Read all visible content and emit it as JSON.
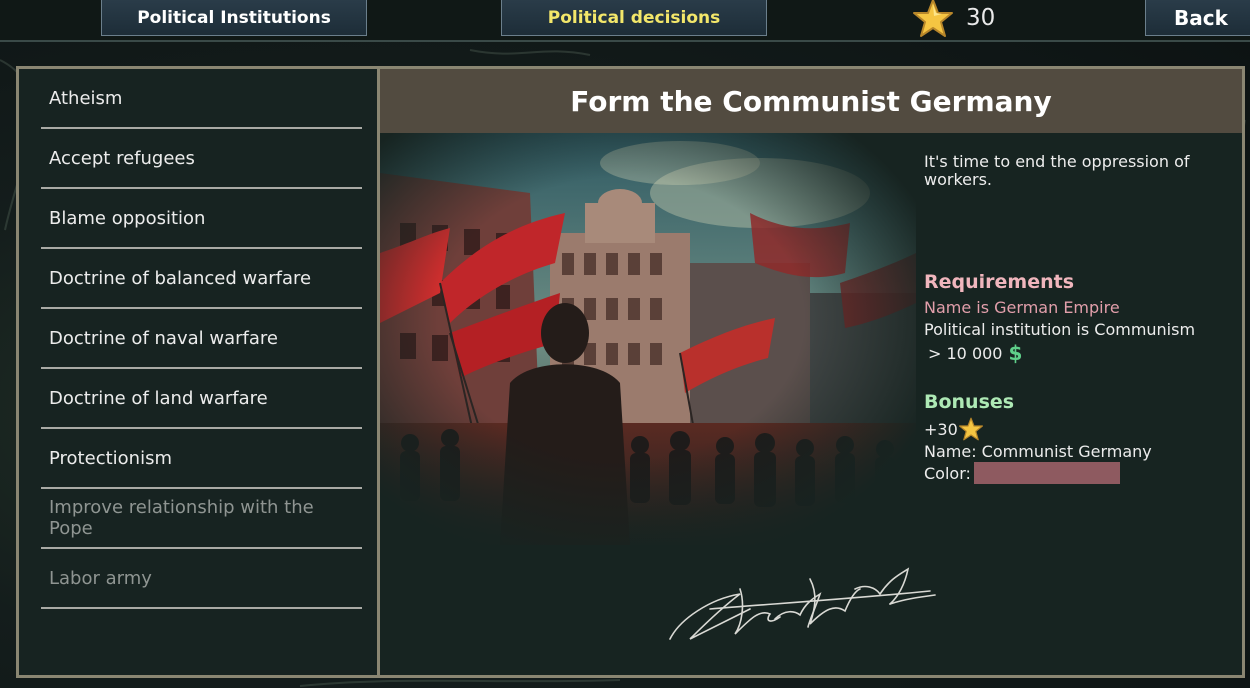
{
  "topbar": {
    "institutions_label": "Political Institutions",
    "decisions_label": "Political decisions",
    "stars_count": "30",
    "back_label": "Back"
  },
  "sidebar": {
    "items": [
      {
        "label": "Atheism",
        "enabled": true
      },
      {
        "label": "Accept refugees",
        "enabled": true
      },
      {
        "label": "Blame opposition",
        "enabled": true
      },
      {
        "label": "Doctrine of balanced warfare",
        "enabled": true
      },
      {
        "label": "Doctrine of naval warfare",
        "enabled": true
      },
      {
        "label": "Doctrine of land warfare",
        "enabled": true
      },
      {
        "label": "Protectionism",
        "enabled": true
      },
      {
        "label": "Improve relationship with the Pope",
        "enabled": false
      },
      {
        "label": "Labor army",
        "enabled": false
      }
    ]
  },
  "decision": {
    "title": "Form the Communist Germany",
    "description": "It's time to end the oppression of workers.",
    "requirements_heading": "Requirements",
    "requirements": {
      "name": "Name is German Empire",
      "institution": "Political institution is Communism",
      "money": "> 10 000"
    },
    "money_icon": "dollar-icon",
    "bonuses_heading": "Bonuses",
    "bonuses": {
      "stars": "+30",
      "name": "Name: Communist Germany",
      "color_label": "Color:"
    },
    "bonus_color": "#8e5a60"
  },
  "colors": {
    "accent_yellow": "#f3e76a",
    "requirement_unmet": "#e29fab",
    "bonus_heading": "#aee9b5",
    "money_green": "#5fd08a"
  }
}
